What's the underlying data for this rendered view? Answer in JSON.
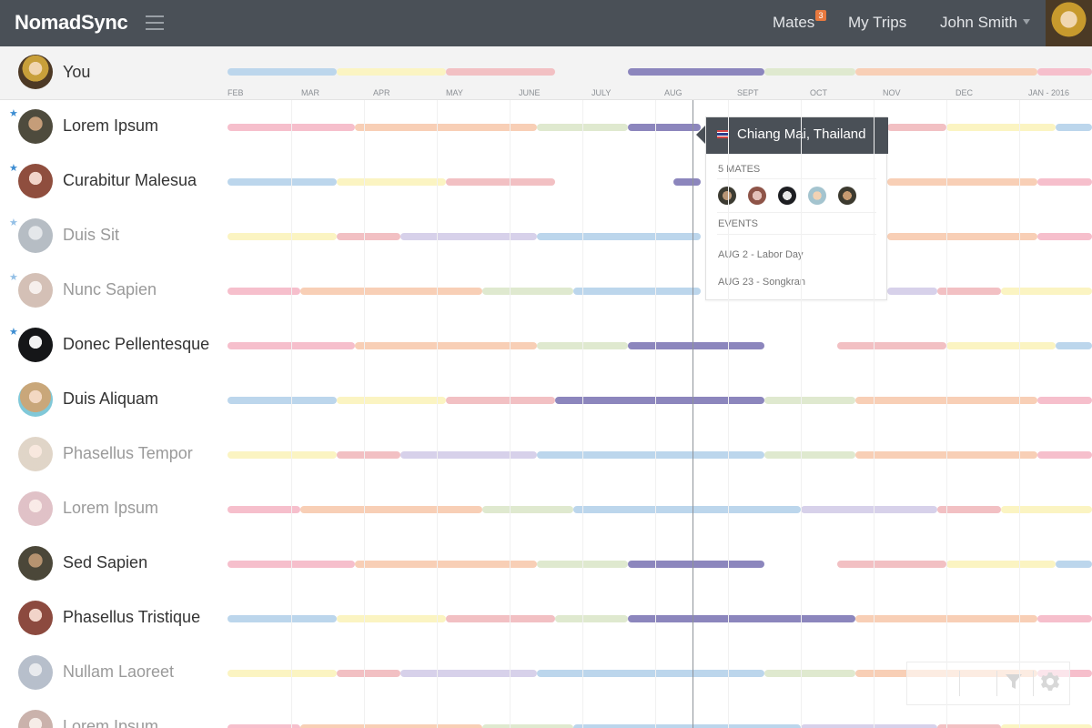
{
  "app": {
    "brand": "NomadSync",
    "nav": {
      "mates_label": "Mates",
      "mates_badge": "3",
      "trips_label": "My Trips",
      "user_name": "John Smith"
    }
  },
  "self": {
    "label": "You",
    "months": [
      "FEB",
      "MAR",
      "APR",
      "MAY",
      "JUNE",
      "JULY",
      "AUG",
      "SEPT",
      "OCT",
      "NOV",
      "DEC",
      "JAN - 2016"
    ]
  },
  "mates": [
    {
      "name": "Lorem Ipsum",
      "starred": true,
      "muted": false
    },
    {
      "name": "Curabitur Malesua",
      "starred": true,
      "muted": false
    },
    {
      "name": "Duis Sit",
      "starred": true,
      "muted": true
    },
    {
      "name": "Nunc Sapien",
      "starred": true,
      "muted": true
    },
    {
      "name": "Donec Pellentesque",
      "starred": true,
      "muted": false
    },
    {
      "name": "Duis Aliquam",
      "starred": false,
      "muted": false
    },
    {
      "name": "Phasellus Tempor",
      "starred": false,
      "muted": true
    },
    {
      "name": "Lorem Ipsum",
      "starred": false,
      "muted": true
    },
    {
      "name": "Sed Sapien",
      "starred": false,
      "muted": false
    },
    {
      "name": "Phasellus Tristique",
      "starred": false,
      "muted": false
    },
    {
      "name": "Nullam Laoreet",
      "starred": false,
      "muted": true
    },
    {
      "name": "Lorem Ipsum",
      "starred": false,
      "muted": true
    }
  ],
  "popover": {
    "location": "Chiang Mai, Thailand",
    "mates_heading": "5 MATES",
    "events_heading": "EVENTS",
    "events": [
      "AUG 2 - Labor Day",
      "AUG 23 - Songkran"
    ]
  },
  "colors": {
    "header": "#4a5057",
    "accent": "#e8793f",
    "blue": "#bcd6ec",
    "yellow": "#fbf4c2",
    "red": "#f2c0c3",
    "purple": "#8c86bd",
    "green": "#dfe9cf",
    "peach": "#f8cfb6",
    "pink": "#f6bfcc",
    "lavender": "#d7d1ea",
    "star": "#3d8dd2"
  },
  "icons": {
    "menu": "hamburger-icon",
    "dropdown": "chevron-down-icon",
    "filter": "filter-icon",
    "settings": "gear-icon",
    "flag": "thailand-flag-icon",
    "star": "star-icon"
  }
}
